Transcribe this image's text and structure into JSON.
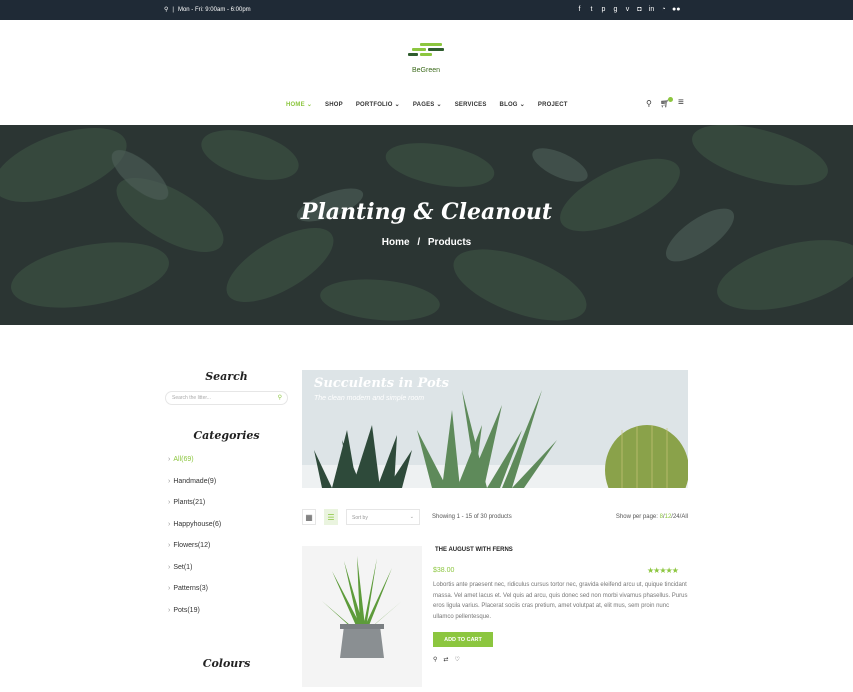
{
  "topbar": {
    "hours": "Mon - Fri: 9:00am - 6:00pm",
    "social_icons": [
      "facebook-icon",
      "twitter-icon",
      "pinterest-icon",
      "google-plus-icon",
      "vimeo-icon",
      "instagram-icon",
      "linkedin-icon",
      "rss-icon",
      "flickr-icon"
    ]
  },
  "logo": {
    "name": "BeGreen",
    "color": "#8cc63f"
  },
  "nav": {
    "items": [
      {
        "label": "HOME",
        "dropdown": true
      },
      {
        "label": "SHOP",
        "dropdown": false
      },
      {
        "label": "PORTFOLIO",
        "dropdown": true
      },
      {
        "label": "PAGES",
        "dropdown": true
      },
      {
        "label": "SERVICES",
        "dropdown": false
      },
      {
        "label": "BLOG",
        "dropdown": true
      },
      {
        "label": "PROJECT",
        "dropdown": false
      }
    ]
  },
  "hero": {
    "title": "Planting & Cleanout",
    "crumb_home": "Home",
    "crumb_sep": "/",
    "crumb_current": "Products"
  },
  "sidebar": {
    "search_title": "Search",
    "search_placeholder": "Search the litter...",
    "categories_title": "Categories",
    "categories": [
      "All(69)",
      "Handmade(9)",
      "Plants(21)",
      "Happyhouse(6)",
      "Flowers(12)",
      "Set(1)",
      "Patterns(3)",
      "Pots(19)"
    ],
    "colours_title": "Colours"
  },
  "banner": {
    "title": "Succulents in Pots",
    "subtitle": "The clean modern and simple room"
  },
  "toolbar": {
    "sort_placeholder": "Sort by",
    "showing": "Showing 1 - 15 of 30 products",
    "perpage_label": "Show per page:",
    "perpage_options": [
      "8",
      "12",
      "24",
      "All"
    ]
  },
  "product": {
    "title": "THE AUGUST WITH FERNS",
    "price": "$38.00",
    "rating": 5,
    "stars": "★★★★★",
    "description": "Lobortis ante praesent nec, ridiculus cursus tortor nec, gravida eleifend arcu ut, quique tincidant massa. Vel amet lacus et. Vel quis ad arcu, quis donec sed non morbi vivamus phasellus. Purus eros ligula varius. Placerat sociis cras pretium, amet volutpat at, elit mus, sem proin nunc ullamco pellentesque.",
    "add_to_cart": "ADD TO CART"
  }
}
